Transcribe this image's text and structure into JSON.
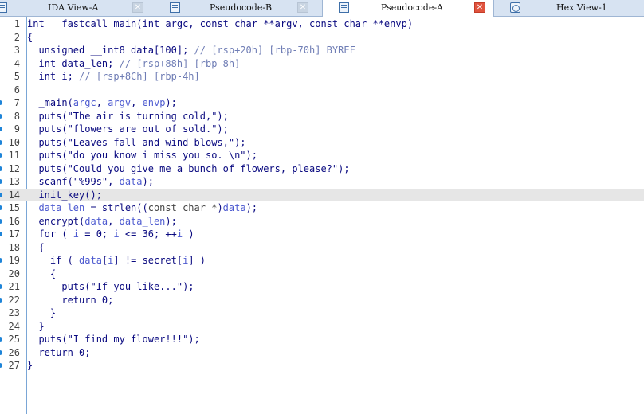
{
  "tabs": [
    {
      "label": "IDA View-A",
      "icon": "listing-icon",
      "active": false
    },
    {
      "label": "Pseudocode-B",
      "icon": "listing-icon",
      "active": false
    },
    {
      "label": "Pseudocode-A",
      "icon": "listing-icon",
      "active": true
    },
    {
      "label": "Hex View-1",
      "icon": "hex-icon",
      "active": false
    }
  ],
  "close_glyph": "✕",
  "code_lines": [
    {
      "no": "1",
      "bp": false,
      "hl": false,
      "segs": [
        [
          "int __fastcall main(int argc, const char **argv, const char **envp)",
          "normal"
        ]
      ]
    },
    {
      "no": "2",
      "bp": false,
      "hl": false,
      "segs": [
        [
          "{",
          "normal"
        ]
      ]
    },
    {
      "no": "3",
      "bp": false,
      "hl": false,
      "segs": [
        [
          "  unsigned __int8 data[100]; ",
          "normal"
        ],
        [
          "// [rsp+20h] [rbp-70h] BYREF",
          "cmt"
        ]
      ]
    },
    {
      "no": "4",
      "bp": false,
      "hl": false,
      "segs": [
        [
          "  int data_len; ",
          "normal"
        ],
        [
          "// [rsp+88h] [rbp-8h]",
          "cmt"
        ]
      ]
    },
    {
      "no": "5",
      "bp": false,
      "hl": false,
      "segs": [
        [
          "  int i; ",
          "normal"
        ],
        [
          "// [rsp+8Ch] [rbp-4h]",
          "cmt"
        ]
      ]
    },
    {
      "no": "6",
      "bp": false,
      "hl": false,
      "segs": [
        [
          "",
          "normal"
        ]
      ]
    },
    {
      "no": "7",
      "bp": true,
      "hl": false,
      "segs": [
        [
          "  _main(",
          "normal"
        ],
        [
          "argc",
          "var"
        ],
        [
          ", ",
          "normal"
        ],
        [
          "argv",
          "var"
        ],
        [
          ", ",
          "normal"
        ],
        [
          "envp",
          "var"
        ],
        [
          ");",
          "normal"
        ]
      ]
    },
    {
      "no": "8",
      "bp": true,
      "hl": false,
      "segs": [
        [
          "  puts(\"The air is turning cold,\");",
          "normal"
        ]
      ]
    },
    {
      "no": "9",
      "bp": true,
      "hl": false,
      "segs": [
        [
          "  puts(\"flowers are out of sold.\");",
          "normal"
        ]
      ]
    },
    {
      "no": "10",
      "bp": true,
      "hl": false,
      "segs": [
        [
          "  puts(\"Leaves fall and wind blows,\");",
          "normal"
        ]
      ]
    },
    {
      "no": "11",
      "bp": true,
      "hl": false,
      "segs": [
        [
          "  puts(\"do you know i miss you so. \\n\");",
          "normal"
        ]
      ]
    },
    {
      "no": "12",
      "bp": true,
      "hl": false,
      "segs": [
        [
          "  puts(\"Could you give me a bunch of flowers, please?\");",
          "normal"
        ]
      ]
    },
    {
      "no": "13",
      "bp": true,
      "hl": false,
      "segs": [
        [
          "  scanf(\"%99s\", ",
          "normal"
        ],
        [
          "data",
          "var"
        ],
        [
          ");",
          "normal"
        ]
      ]
    },
    {
      "no": "14",
      "bp": true,
      "hl": true,
      "segs": [
        [
          "  init_key();",
          "normal"
        ]
      ]
    },
    {
      "no": "15",
      "bp": true,
      "hl": false,
      "segs": [
        [
          "  ",
          "normal"
        ],
        [
          "data_len",
          "var"
        ],
        [
          " = strlen((",
          "normal"
        ],
        [
          "const char *",
          "gray"
        ],
        [
          ")",
          "normal"
        ],
        [
          "data",
          "var"
        ],
        [
          ");",
          "normal"
        ]
      ]
    },
    {
      "no": "16",
      "bp": true,
      "hl": false,
      "segs": [
        [
          "  encrypt(",
          "normal"
        ],
        [
          "data",
          "var"
        ],
        [
          ", ",
          "normal"
        ],
        [
          "data_len",
          "var"
        ],
        [
          ");",
          "normal"
        ]
      ]
    },
    {
      "no": "17",
      "bp": true,
      "hl": false,
      "segs": [
        [
          "  for ( ",
          "normal"
        ],
        [
          "i",
          "var"
        ],
        [
          " = 0; ",
          "normal"
        ],
        [
          "i",
          "var"
        ],
        [
          " <= 36; ++",
          "normal"
        ],
        [
          "i",
          "var"
        ],
        [
          " )",
          "normal"
        ]
      ]
    },
    {
      "no": "18",
      "bp": false,
      "hl": false,
      "segs": [
        [
          "  {",
          "normal"
        ]
      ]
    },
    {
      "no": "19",
      "bp": true,
      "hl": false,
      "segs": [
        [
          "    if ( ",
          "normal"
        ],
        [
          "data",
          "var"
        ],
        [
          "[",
          "normal"
        ],
        [
          "i",
          "var"
        ],
        [
          "] != secret[",
          "normal"
        ],
        [
          "i",
          "var"
        ],
        [
          "] )",
          "normal"
        ]
      ]
    },
    {
      "no": "20",
      "bp": false,
      "hl": false,
      "segs": [
        [
          "    {",
          "normal"
        ]
      ]
    },
    {
      "no": "21",
      "bp": true,
      "hl": false,
      "segs": [
        [
          "      puts(\"If you like...\");",
          "normal"
        ]
      ]
    },
    {
      "no": "22",
      "bp": true,
      "hl": false,
      "segs": [
        [
          "      return 0;",
          "normal"
        ]
      ]
    },
    {
      "no": "23",
      "bp": false,
      "hl": false,
      "segs": [
        [
          "    }",
          "normal"
        ]
      ]
    },
    {
      "no": "24",
      "bp": false,
      "hl": false,
      "segs": [
        [
          "  }",
          "normal"
        ]
      ]
    },
    {
      "no": "25",
      "bp": true,
      "hl": false,
      "segs": [
        [
          "  puts(\"I find my flower!!!\");",
          "normal"
        ]
      ]
    },
    {
      "no": "26",
      "bp": true,
      "hl": false,
      "segs": [
        [
          "  return 0;",
          "normal"
        ]
      ]
    },
    {
      "no": "27",
      "bp": true,
      "hl": false,
      "segs": [
        [
          "}",
          "normal"
        ]
      ]
    }
  ]
}
